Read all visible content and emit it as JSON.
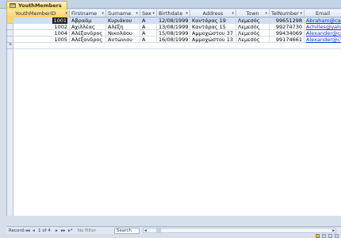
{
  "tab": {
    "title": "YouthMembers"
  },
  "columns": [
    {
      "label": "YouthMemberID",
      "sort": "▾"
    },
    {
      "label": "Firstname",
      "sort": "▾"
    },
    {
      "label": "Surname",
      "sort": "▾"
    },
    {
      "label": "Sex",
      "sort": "▾"
    },
    {
      "label": "Birthdate",
      "sort": "▾"
    },
    {
      "label": "Address",
      "sort": "▾"
    },
    {
      "label": "Town",
      "sort": "▾"
    },
    {
      "label": "TelNumber",
      "sort": "▾"
    },
    {
      "label": "Email",
      "sort": ""
    }
  ],
  "rows": [
    {
      "id": "1001",
      "firstname": "Αβραάμ",
      "surname": "Κυριάκου",
      "sex": "A",
      "birthdate": "12/08/1999",
      "address": "Καντάρας 19",
      "town": "Λεμεσός",
      "tel": "99651298",
      "email": "Abraham@cable"
    },
    {
      "id": "1002",
      "firstname": "Αχιλλέας",
      "surname": "Αλέξη",
      "sex": "A",
      "birthdate": "13/08/1999",
      "address": "Καντάρας 15",
      "town": "Λεμεσός",
      "tel": "99274730",
      "email": "Achilles@yahoo"
    },
    {
      "id": "1004",
      "firstname": "Αλέξανδρος",
      "surname": "Νικολάου",
      "sex": "A",
      "birthdate": "15/08/1999",
      "address": "Αμμοχώστου 37",
      "town": "Λεμεσός",
      "tel": "99434069",
      "email": "Alexander@cab"
    },
    {
      "id": "1005",
      "firstname": "Αλέξανδρος",
      "surname": "Αντώνιου",
      "sex": "A",
      "birthdate": "16/08/1999",
      "address": "Αμμοχώστου 13",
      "town": "Λεμεσός",
      "tel": "99174661",
      "email": "Alexander@cyta"
    }
  ],
  "new_row_marker": "*",
  "status": {
    "record_label": "Record:",
    "first": "◂◂",
    "prev": "◂",
    "position": "1 of 4",
    "next": "▸",
    "last": "▸▸",
    "new": "▸*",
    "filter": "No Filter",
    "search": "Search",
    "scroll_left": "◂",
    "scroll_right": "▸"
  },
  "colors": {
    "accent": "#ffd86b",
    "selected_row": "#cfe0f5",
    "link": "#0b34c9"
  }
}
